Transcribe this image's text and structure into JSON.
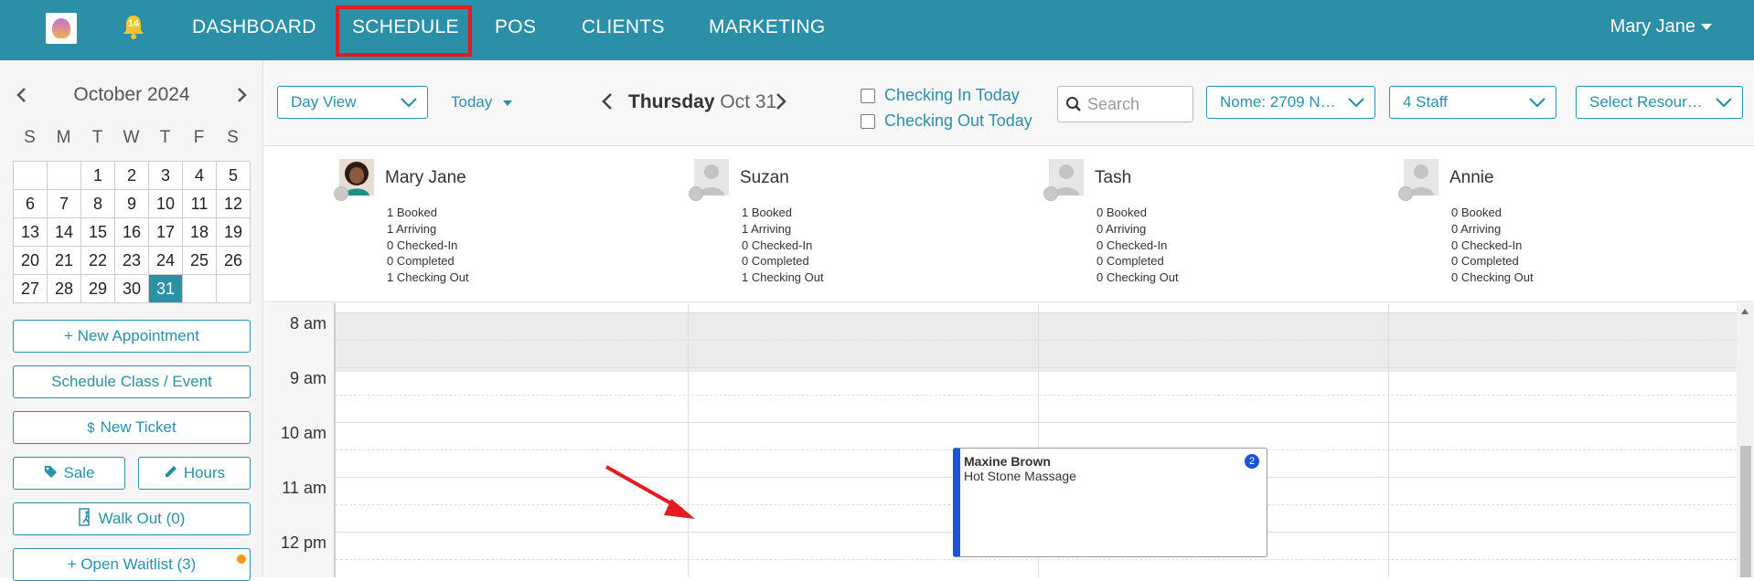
{
  "nav": {
    "notification_count": "14",
    "items": [
      {
        "label": "DASHBOARD"
      },
      {
        "label": "SCHEDULE"
      },
      {
        "label": "POS"
      },
      {
        "label": "CLIENTS"
      },
      {
        "label": "MARKETING"
      }
    ],
    "active_item": "SCHEDULE",
    "user_name": "Mary Jane"
  },
  "calendar": {
    "month_label": "October 2024",
    "weekdays": [
      "S",
      "M",
      "T",
      "W",
      "T",
      "F",
      "S"
    ],
    "cells": [
      "",
      "",
      "1",
      "2",
      "3",
      "4",
      "5",
      "6",
      "7",
      "8",
      "9",
      "10",
      "11",
      "12",
      "13",
      "14",
      "15",
      "16",
      "17",
      "18",
      "19",
      "20",
      "21",
      "22",
      "23",
      "24",
      "25",
      "26",
      "27",
      "28",
      "29",
      "30",
      "31",
      "",
      ""
    ],
    "selected": "31"
  },
  "sidebar": {
    "new_appointment": "+ New Appointment",
    "schedule_class": "Schedule Class / Event",
    "new_ticket": "New Ticket",
    "new_ticket_icon": "$",
    "sale": "Sale",
    "hours": "Hours",
    "walk_out": "Walk Out (0)",
    "open_waitlist": "+ Open Waitlist (3)"
  },
  "toolbar": {
    "view_select": "Day View",
    "today_label": "Today",
    "date_day": "Thursday",
    "date_rest": "Oct 31",
    "checking_in": "Checking In Today",
    "checking_out": "Checking Out Today",
    "search_placeholder": "Search",
    "location_select": "Nome: 2709 N…",
    "staff_select": "4 Staff",
    "resource_select": "Select Resour…"
  },
  "staff": [
    {
      "name": "Mary Jane",
      "stats": [
        "1 Booked",
        "1 Arriving",
        "0 Checked-In",
        "0 Completed",
        "1 Checking Out"
      ]
    },
    {
      "name": "Suzan",
      "stats": [
        "1 Booked",
        "1 Arriving",
        "0 Checked-In",
        "0 Completed",
        "1 Checking Out"
      ]
    },
    {
      "name": "Tash",
      "stats": [
        "0 Booked",
        "0 Arriving",
        "0 Checked-In",
        "0 Completed",
        "0 Checking Out"
      ]
    },
    {
      "name": "Annie",
      "stats": [
        "0 Booked",
        "0 Arriving",
        "0 Checked-In",
        "0 Completed",
        "0 Checking Out"
      ]
    }
  ],
  "schedule": {
    "time_labels": [
      "8 am",
      "9 am",
      "10 am",
      "11 am",
      "12 pm"
    ],
    "appointment": {
      "client": "Maxine Brown",
      "service": "Hot Stone Massage",
      "badge": "2"
    }
  },
  "colors": {
    "brand": "#2c8fa8",
    "highlight": "#e51b23",
    "appointment_accent": "#1a55d6",
    "waitlist_dot": "#f39c12"
  }
}
